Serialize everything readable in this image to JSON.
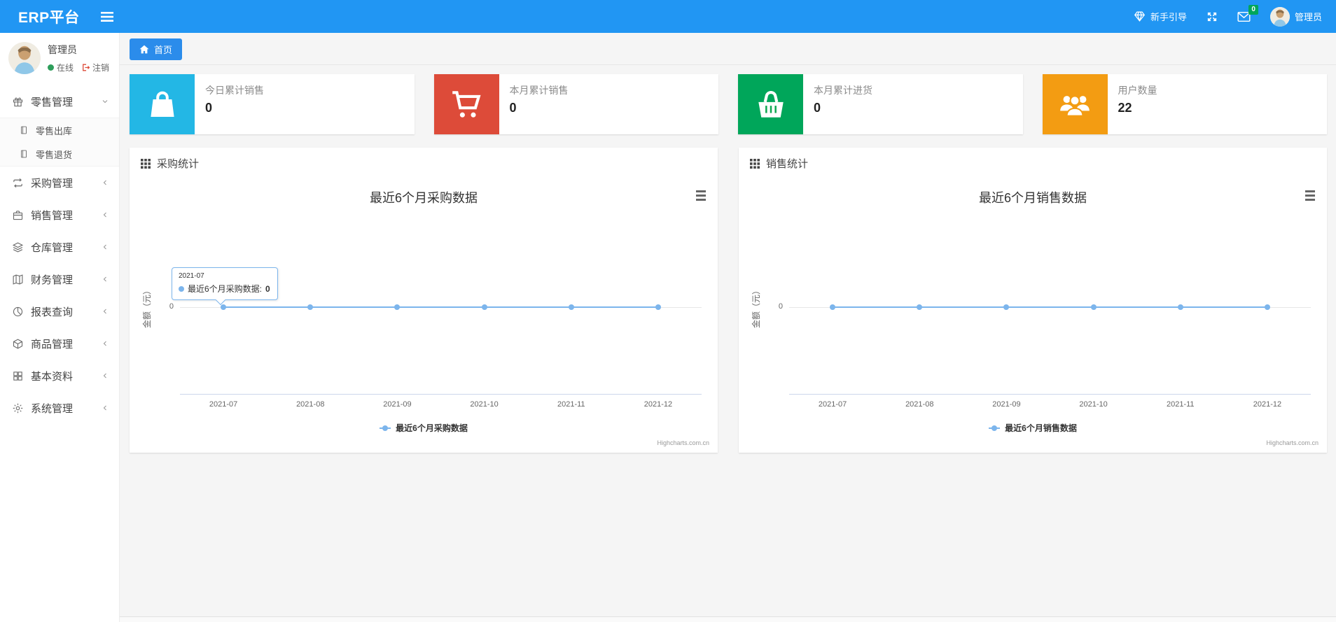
{
  "colors": {
    "navbar": "#2196f3",
    "tab_active": "#2b8ceb",
    "chart_line": "#7cb5ec",
    "badge_green": "#00a65a",
    "status_online": "#2e9e5b",
    "logout_red": "#dd4b39"
  },
  "navbar": {
    "brand": "ERP平台",
    "guide_label": "新手引导",
    "mail_badge": "0",
    "username": "管理员"
  },
  "sidebar": {
    "user": {
      "name": "管理员",
      "status": "在线",
      "logout": "注销"
    },
    "items": [
      {
        "label": "零售管理",
        "icon": "gift-icon",
        "state": "expanded",
        "children": [
          {
            "label": "零售出库",
            "icon": "journal-icon"
          },
          {
            "label": "零售退货",
            "icon": "journal-icon"
          }
        ]
      },
      {
        "label": "采购管理",
        "icon": "repeat-icon",
        "state": "collapsed"
      },
      {
        "label": "销售管理",
        "icon": "briefcase-icon",
        "state": "collapsed"
      },
      {
        "label": "仓库管理",
        "icon": "layers-icon",
        "state": "collapsed"
      },
      {
        "label": "财务管理",
        "icon": "map-book-icon",
        "state": "collapsed"
      },
      {
        "label": "报表查询",
        "icon": "pie-chart-icon",
        "state": "collapsed"
      },
      {
        "label": "商品管理",
        "icon": "box-icon",
        "state": "collapsed"
      },
      {
        "label": "基本资料",
        "icon": "grid-icon",
        "state": "collapsed"
      },
      {
        "label": "系统管理",
        "icon": "gear-icon",
        "state": "collapsed"
      }
    ]
  },
  "tabs": [
    {
      "label": "首页",
      "icon": "home-icon",
      "active": true
    }
  ],
  "stat_cards": [
    {
      "label": "今日累计销售",
      "value": "0",
      "color": "#23b7e5",
      "icon": "shopping-bag-icon"
    },
    {
      "label": "本月累计销售",
      "value": "0",
      "color": "#dd4b39",
      "icon": "shopping-cart-icon"
    },
    {
      "label": "本月累计进货",
      "value": "0",
      "color": "#00a65a",
      "icon": "shopping-basket-icon"
    },
    {
      "label": "用户数量",
      "value": "22",
      "color": "#f39c12",
      "icon": "users-icon"
    }
  ],
  "panels": [
    {
      "header": "采购统计"
    },
    {
      "header": "销售统计"
    }
  ],
  "chart_data": [
    {
      "type": "line",
      "title": "最近6个月采购数据",
      "categories": [
        "2021-07",
        "2021-08",
        "2021-09",
        "2021-10",
        "2021-11",
        "2021-12"
      ],
      "series": [
        {
          "name": "最近6个月采购数据",
          "values": [
            0,
            0,
            0,
            0,
            0,
            0
          ],
          "color": "#7cb5ec"
        }
      ],
      "xlabel": "",
      "ylabel": "金额（元）",
      "yticks": [
        "0"
      ],
      "ylim": [
        -1,
        1
      ],
      "grid": true,
      "legend_position": "bottom",
      "credits": "Highcharts.com.cn",
      "tooltip": {
        "visible": true,
        "category": "2021-07",
        "label": "最近6个月采购数据:",
        "value": "0"
      }
    },
    {
      "type": "line",
      "title": "最近6个月销售数据",
      "categories": [
        "2021-07",
        "2021-08",
        "2021-09",
        "2021-10",
        "2021-11",
        "2021-12"
      ],
      "series": [
        {
          "name": "最近6个月销售数据",
          "values": [
            0,
            0,
            0,
            0,
            0,
            0
          ],
          "color": "#7cb5ec"
        }
      ],
      "xlabel": "",
      "ylabel": "金额（元）",
      "yticks": [
        "0"
      ],
      "ylim": [
        -1,
        1
      ],
      "grid": true,
      "legend_position": "bottom",
      "credits": "Highcharts.com.cn",
      "tooltip": {
        "visible": false
      }
    }
  ]
}
